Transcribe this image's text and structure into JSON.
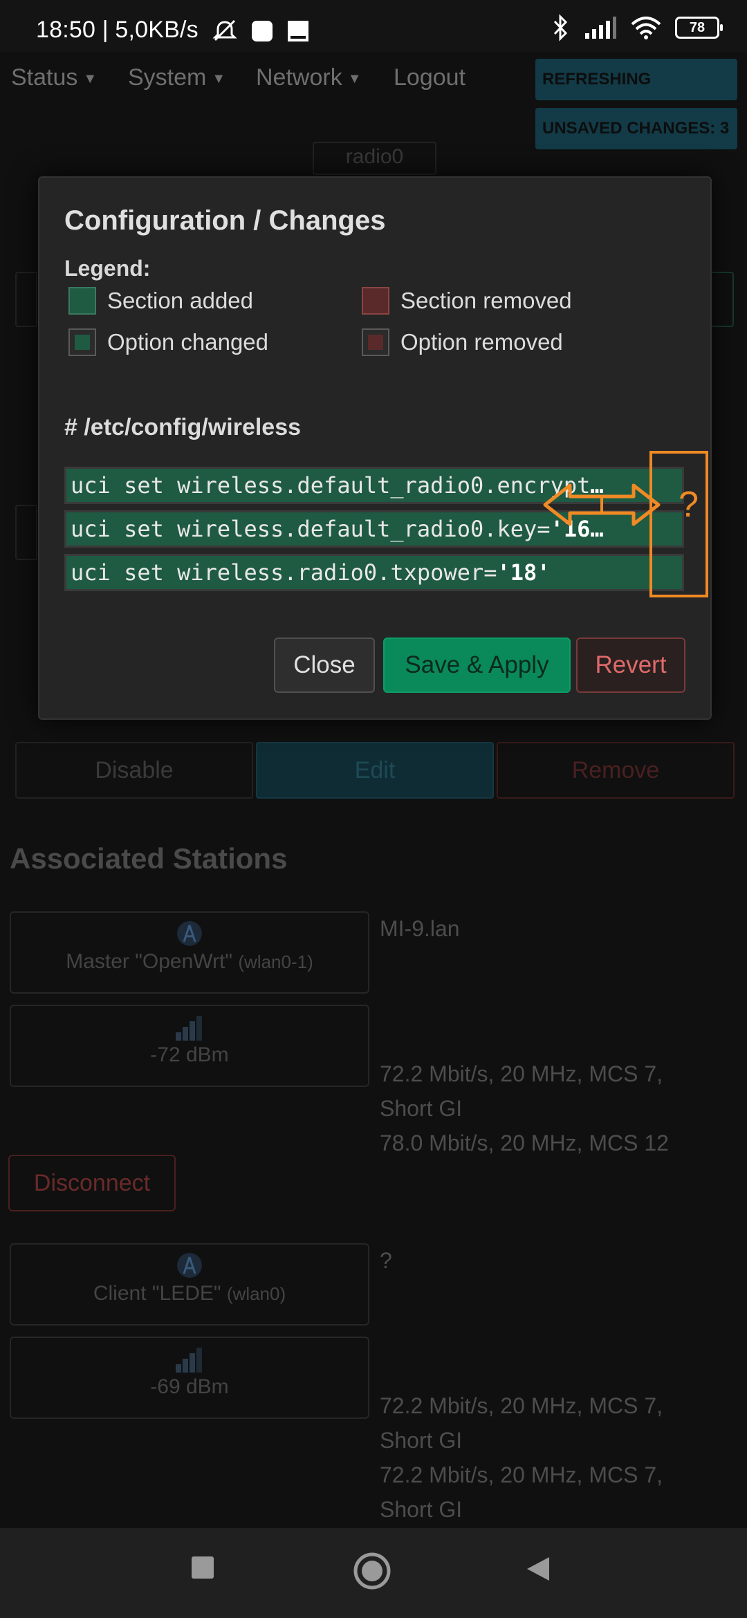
{
  "status_bar": {
    "time_speed": "18:50 | 5,0KB/s",
    "battery": "78",
    "icons": [
      "mute-icon",
      "square-icon",
      "download-icon",
      "bluetooth-icon",
      "signal-icon",
      "wifi-icon",
      "battery-icon"
    ]
  },
  "nav": {
    "items": [
      {
        "label": "Status"
      },
      {
        "label": "System"
      },
      {
        "label": "Network"
      },
      {
        "label": "Logout"
      }
    ],
    "badges": {
      "refreshing": "REFRESHING",
      "unsaved": "UNSAVED CHANGES: 3"
    }
  },
  "background": {
    "radio_label": "radio0",
    "row_buttons": {
      "disable": "Disable",
      "edit": "Edit",
      "remove": "Remove"
    },
    "associated_title": "Associated Stations",
    "stations": [
      {
        "host": "Master \"OpenWrt\"",
        "iface": "(wlan0-1)",
        "hostname": "MI-9.lan",
        "signal": "-72 dBm",
        "rx": "72.2 Mbit/s, 20 MHz, MCS 7,",
        "rx2": "Short GI",
        "tx": "78.0 Mbit/s, 20 MHz, MCS 12"
      },
      {
        "host": "Client \"LEDE\"",
        "iface": "(wlan0)",
        "hostname": "?",
        "signal": "-69 dBm",
        "rx": "72.2 Mbit/s, 20 MHz, MCS 7,",
        "rx2": "Short GI",
        "tx": "72.2 Mbit/s, 20 MHz, MCS 7,",
        "tx2": "Short GI"
      }
    ],
    "disconnect": "Disconnect"
  },
  "modal": {
    "title": "Configuration / Changes",
    "legend_title": "Legend:",
    "legend": {
      "section_added": "Section added",
      "section_removed": "Section removed",
      "option_changed": "Option changed",
      "option_removed": "Option removed"
    },
    "file": "# /etc/config/wireless",
    "changes": [
      {
        "cmd": "uci set wireless.default_radio0.encrypt",
        "val": "…"
      },
      {
        "cmd": "uci set wireless.default_radio0.key=",
        "val": "'16…"
      },
      {
        "cmd": "uci set wireless.radio0.txpower=",
        "val": "'18'"
      }
    ],
    "buttons": {
      "close": "Close",
      "save_apply": "Save & Apply",
      "revert": "Revert"
    }
  },
  "annotation": {
    "mark": "?"
  },
  "colors": {
    "accent_green": "#0a8a5a",
    "added_green": "#1f5a43",
    "removed_red": "#5a2a2a",
    "annotation_orange": "#f08a24"
  }
}
